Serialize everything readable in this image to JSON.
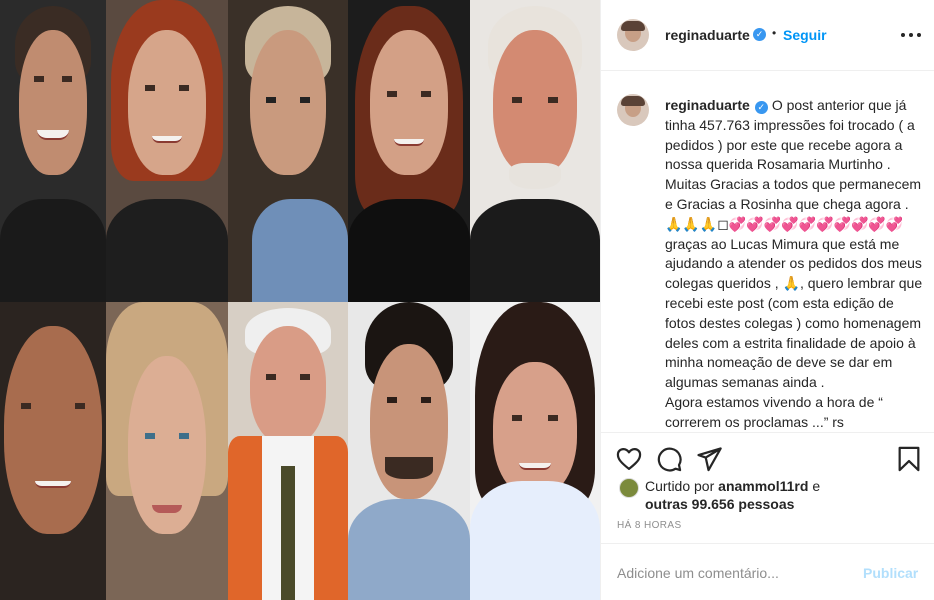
{
  "post": {
    "author": "reginaduarte",
    "verified_icon": "verified-badge-icon",
    "separator": "•",
    "follow_label": "Seguir",
    "more_icon": "more-options-icon"
  },
  "caption": {
    "author": "reginaduarte",
    "text": "O post anterior que já tinha 457.763 impressões foi trocado ( a pedidos ) por este que recebe agora a nossa querida Rosamaria Murtinho . Muitas Gracias a todos que permanecem e Gracias a Rosinha que chega agora . 🙏🙏🙏◻💞💞💞💞💞💞💞💞💞💞graças ao Lucas Mimura que está me ajudando a atender os pedidos dos meus colegas queridos , 🙏, quero lembrar que recebi este post (com esta edição de fotos destes colegas ) como homenagem deles com a estrita finalidade de apoio à minha nomeação de deve se dar em algumas semanas ainda .\nAgora estamos vivendo a hora de “ correrem os proclamas ...” rs"
  },
  "actions": {
    "like_icon": "heart-icon",
    "comment_icon": "comment-icon",
    "share_icon": "paper-plane-icon",
    "save_icon": "bookmark-icon"
  },
  "likes": {
    "prefix": "Curtido por",
    "first_user": "anammol11rd",
    "conjunction": "e",
    "others": "outras 99.656 pessoas"
  },
  "timestamp": "HÁ 8 HORAS",
  "comment": {
    "placeholder": "Adicione um comentário...",
    "publish_label": "Publicar"
  },
  "colors": {
    "accent": "#0095f6",
    "verified": "#3897f0",
    "publish_disabled": "#b2dffc",
    "muted": "#8e8e8e",
    "text": "#262626"
  },
  "photo": {
    "description_icons": [
      "portrait-photo-collage"
    ]
  }
}
